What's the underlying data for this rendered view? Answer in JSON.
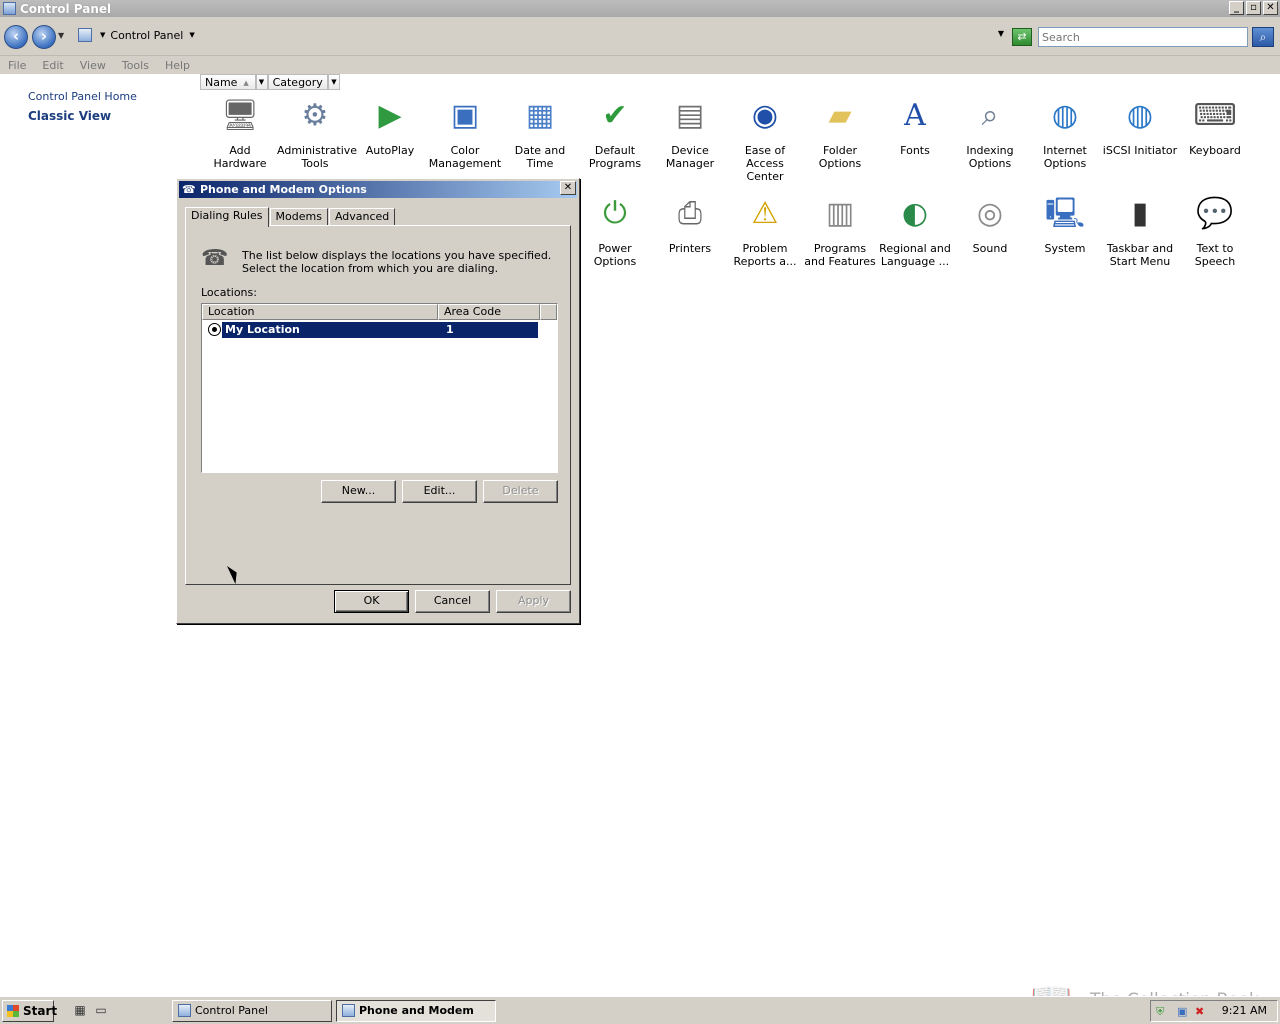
{
  "window": {
    "title": "Control Panel"
  },
  "address": {
    "path": "Control Panel",
    "search_placeholder": "Search"
  },
  "menu": [
    "File",
    "Edit",
    "View",
    "Tools",
    "Help"
  ],
  "left_pane": {
    "home_link": "Control Panel Home",
    "classic_view": "Classic View"
  },
  "columns": {
    "name": "Name",
    "category": "Category"
  },
  "icons": [
    {
      "label": "Add Hardware",
      "icon": "add-hardware-icon"
    },
    {
      "label": "Administrative Tools",
      "icon": "administrative-tools-icon"
    },
    {
      "label": "AutoPlay",
      "icon": "autoplay-icon"
    },
    {
      "label": "Color Management",
      "icon": "color-management-icon"
    },
    {
      "label": "Date and Time",
      "icon": "date-and-time-icon"
    },
    {
      "label": "Default Programs",
      "icon": "default-programs-icon"
    },
    {
      "label": "Device Manager",
      "icon": "device-manager-icon"
    },
    {
      "label": "Ease of Access Center",
      "icon": "ease-of-access-icon"
    },
    {
      "label": "Folder Options",
      "icon": "folder-options-icon"
    },
    {
      "label": "Fonts",
      "icon": "fonts-icon"
    },
    {
      "label": "Indexing Options",
      "icon": "indexing-options-icon"
    },
    {
      "label": "Internet Options",
      "icon": "internet-options-icon"
    },
    {
      "label": "iSCSI Initiator",
      "icon": "iscsi-initiator-icon"
    },
    {
      "label": "Keyboard",
      "icon": "keyboard-icon"
    },
    {
      "label": "Power Options",
      "icon": "power-options-icon"
    },
    {
      "label": "Printers",
      "icon": "printers-icon"
    },
    {
      "label": "Problem Reports a...",
      "icon": "problem-reports-icon"
    },
    {
      "label": "Programs and Features",
      "icon": "programs-and-features-icon"
    },
    {
      "label": "Regional and Language ...",
      "icon": "regional-language-icon"
    },
    {
      "label": "Sound",
      "icon": "sound-icon"
    },
    {
      "label": "System",
      "icon": "system-icon"
    },
    {
      "label": "Taskbar and Start Menu",
      "icon": "taskbar-start-menu-icon"
    },
    {
      "label": "Text to Speech",
      "icon": "text-to-speech-icon"
    }
  ],
  "dialog": {
    "title": "Phone and Modem Options",
    "tabs": [
      "Dialing Rules",
      "Modems",
      "Advanced"
    ],
    "intro": "The list below displays the locations you have specified. Select the location from which you are dialing.",
    "locations_label": "Locations:",
    "list_headers": {
      "location": "Location",
      "area_code": "Area Code"
    },
    "rows": [
      {
        "location": "My Location",
        "area_code": "1"
      }
    ],
    "buttons": {
      "new": "New...",
      "edit": "Edit...",
      "delete": "Delete",
      "ok": "OK",
      "cancel": "Cancel",
      "apply": "Apply"
    }
  },
  "taskbar": {
    "start": "Start",
    "tasks": [
      "Control Panel",
      "Phone and Modem Op..."
    ],
    "clock": "9:21 AM"
  },
  "watermark": "The Collection Book"
}
